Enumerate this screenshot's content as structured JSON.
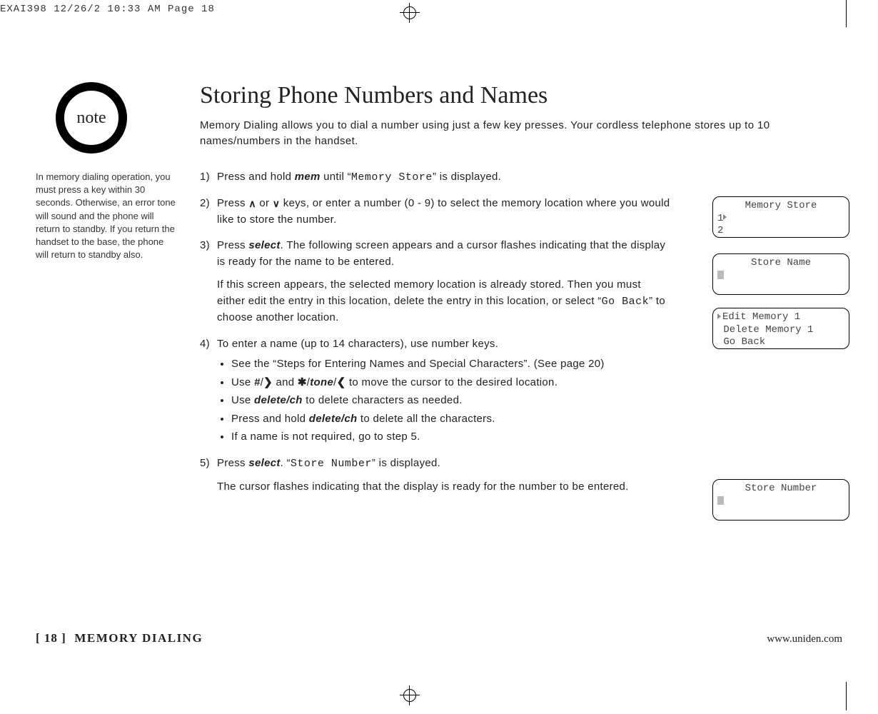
{
  "imposition_header": "EXAI398  12/26/2 10:33 AM  Page 18",
  "note_badge": "note",
  "note_text": "In memory dialing operation, you must press a key within 30 seconds. Otherwise, an error tone will sound and the phone will return to standby. If you return the handset to the base, the phone will return to standby also.",
  "title": "Storing Phone Numbers and Names",
  "intro": "Memory Dialing allows you to dial a number using just a few key presses. Your cordless telephone stores up to 10 names/numbers in the handset.",
  "steps": {
    "s1_num": "1)",
    "s1_a": "Press and hold ",
    "s1_key_mem": "mem",
    "s1_b": " until “",
    "s1_lcd": "Memory Store",
    "s1_c": "” is displayed.",
    "s2_num": "2)",
    "s2_a": "Press ",
    "s2_up": "∧",
    "s2_mid": " or ",
    "s2_down": "∨",
    "s2_b": " keys, or enter a number (0 - 9) to select the memory location where you would like to store the number.",
    "s3_num": "3)",
    "s3_a": "Press ",
    "s3_key_select": "select",
    "s3_b": ". The following screen appears and a cursor flashes indicating that the display is ready for the name to be entered.",
    "s3_cont_a": "If this screen appears, the selected memory location is already stored. Then you must either edit the entry in this location, delete the entry in this location, or select “",
    "s3_cont_lcd": "Go Back",
    "s3_cont_b": "” to choose another location.",
    "s4_num": "4)",
    "s4_a": "To enter a name (up to 14 characters), use number keys.",
    "s4_b1": "See the “Steps for Entering Names and Special Characters”. (See page 20)",
    "s4_b2_a": "Use ",
    "s4_b2_key1": "#",
    "s4_b2_slash1": "/",
    "s4_b2_gt": "❯",
    "s4_b2_mid": "  and  ",
    "s4_b2_star": "✱",
    "s4_b2_slash2": "/",
    "s4_b2_key2": "tone",
    "s4_b2_slash3": "/",
    "s4_b2_lt": "❮",
    "s4_b2_b": " to move the cursor to the desired location.",
    "s4_b3_a": "Use ",
    "s4_b3_key": "delete/ch",
    "s4_b3_b": " to delete characters as needed.",
    "s4_b4_a": "Press and hold ",
    "s4_b4_key": "delete/ch",
    "s4_b4_b": " to delete all the characters.",
    "s4_b5": "If a name is not required, go to step 5.",
    "s5_num": "5)",
    "s5_a": "Press ",
    "s5_key_select": "select",
    "s5_b": ". “",
    "s5_lcd": "Store Number",
    "s5_c": "” is displayed.",
    "s5_cont": "The cursor flashes indicating that the display is ready for the number to be entered."
  },
  "lcds": {
    "memory_store": {
      "title": "Memory Store",
      "row1": "1",
      "row2": "2"
    },
    "store_name": {
      "title": "Store Name"
    },
    "edit_memory": {
      "row1": "Edit Memory 1",
      "row2": " Delete Memory 1",
      "row3": " Go Back"
    },
    "store_number": {
      "title": "Store Number"
    }
  },
  "footer": {
    "page_num": "[ 18 ]",
    "section": "MEMORY DIALING",
    "url": "www.uniden.com"
  }
}
